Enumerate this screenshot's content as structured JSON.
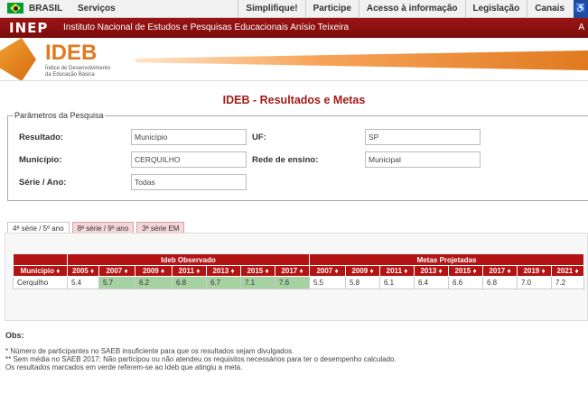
{
  "gov_bar": {
    "country": "BRASIL",
    "services": "Serviços",
    "menu": [
      "Simplifique!",
      "Participe",
      "Acesso à informação",
      "Legislação",
      "Canais"
    ]
  },
  "inep": {
    "logo": "INEP",
    "institute": "Instituto Nacional de Estudos e Pesquisas Educacionais Anísio Teixeira",
    "right_glyph": "A"
  },
  "banner": {
    "title": "IDEB",
    "subtitle_line1": "Índice de Desenvolvimento",
    "subtitle_line2": "da Educação Básica"
  },
  "page_title": "IDEB - Resultados e Metas",
  "params": {
    "legend": "Parâmetros da Pesquisa",
    "resultado_label": "Resultado:",
    "resultado_value": "Município",
    "uf_label": "UF:",
    "uf_value": "SP",
    "municipio_label": "Município:",
    "municipio_value": "CERQUILHO",
    "rede_label": "Rede de ensino:",
    "rede_value": "Municipal",
    "serie_label": "Série / Ano:",
    "serie_value": "Todas"
  },
  "tabs": [
    "4ª série / 5º ano",
    "8ª série / 9º ano",
    "3ª série EM"
  ],
  "table": {
    "group_observado": "Ideb Observado",
    "group_metas": "Metas Projetadas",
    "col_municipio": "Município ♦",
    "observed_years": [
      "2005 ♦",
      "2007 ♦",
      "2009 ♦",
      "2011 ♦",
      "2013 ♦",
      "2015 ♦",
      "2017 ♦"
    ],
    "meta_years": [
      "2007 ♦",
      "2009 ♦",
      "2011 ♦",
      "2013 ♦",
      "2015 ♦",
      "2017 ♦",
      "2019 ♦",
      "2021 ♦"
    ],
    "row": {
      "municipio": "Cerquilho",
      "observed": [
        "5.4",
        "5.7",
        "6.2",
        "6.8",
        "6.7",
        "7.1",
        "7.6"
      ],
      "observed_highlight": [
        false,
        true,
        true,
        true,
        true,
        true,
        true
      ],
      "metas": [
        "5.5",
        "5.8",
        "6.1",
        "6.4",
        "6.6",
        "6.8",
        "7.0",
        "7.2"
      ]
    }
  },
  "obs": {
    "title": "Obs:",
    "notes": [
      "* Número de participantes no SAEB insuficiente para que os resultados sejam divulgados.",
      "** Sem média no SAEB 2017: Não participou ou não atendeu os requisitos necessários para ter o desempenho calculado.",
      "Os resultados marcados em verde referem-se ao Ideb que atingiu a meta."
    ]
  },
  "colors": {
    "brand_red": "#9b1414",
    "header_red": "#b31313",
    "highlight_green": "#a6d1a0",
    "ideb_orange": "#e07a20"
  }
}
